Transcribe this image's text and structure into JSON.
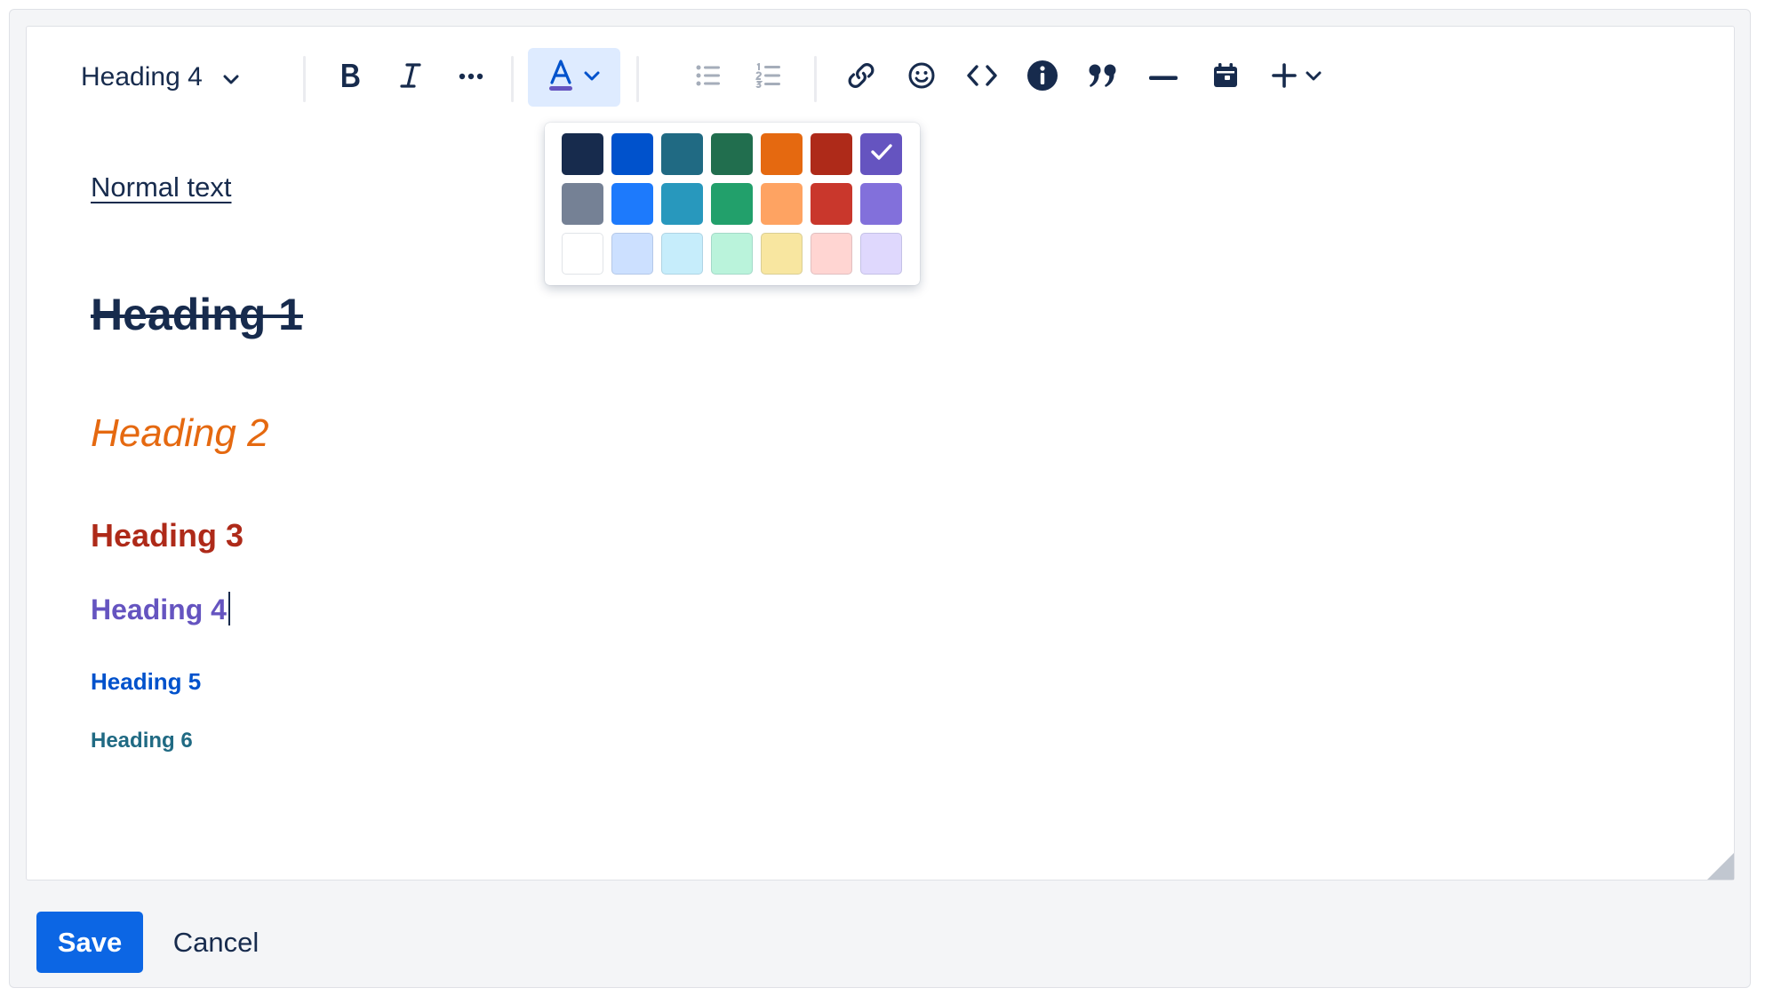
{
  "toolbar": {
    "heading_select": {
      "label": "Heading 4",
      "icon": "chevron-down-icon"
    },
    "buttons": [
      {
        "name": "bold",
        "icon": "bold-icon"
      },
      {
        "name": "italic",
        "icon": "italic-icon"
      },
      {
        "name": "more-formatting",
        "icon": "more-icon"
      },
      {
        "name": "text-color",
        "icon": "text-color-icon"
      },
      {
        "name": "bullet-list",
        "icon": "bullet-list-icon"
      },
      {
        "name": "numbered-list",
        "icon": "numbered-list-icon"
      },
      {
        "name": "link",
        "icon": "link-icon"
      },
      {
        "name": "emoji",
        "icon": "emoji-icon"
      },
      {
        "name": "code",
        "icon": "code-icon"
      },
      {
        "name": "info-panel",
        "icon": "info-icon"
      },
      {
        "name": "quote",
        "icon": "quote-icon"
      },
      {
        "name": "divider",
        "icon": "divider-icon"
      },
      {
        "name": "date",
        "icon": "calendar-icon"
      },
      {
        "name": "insert",
        "icon": "plus-icon"
      }
    ],
    "text_color_underline": "#6554C0"
  },
  "palette": {
    "rows": [
      [
        "#172B4D",
        "#0052CC",
        "#206A83",
        "#216E4E",
        "#E56910",
        "#AE2A19",
        "#6554C0"
      ],
      [
        "#758195",
        "#1D7AFC",
        "#2898BD",
        "#22A06B",
        "#FEA362",
        "#C9372C",
        "#8270DB"
      ],
      [
        "#FFFFFF",
        "#CCE0FF",
        "#C6EDFB",
        "#BAF3DB",
        "#F8E6A0",
        "#FFD5D2",
        "#DFD8FD"
      ]
    ],
    "selected": "#6554C0"
  },
  "content": {
    "normal": {
      "text": "Normal text ",
      "color": "#172B4D"
    },
    "h1": {
      "text": "Heading 1",
      "color": "#172B4D"
    },
    "h2": {
      "text": "Heading 2",
      "color": "#E56910"
    },
    "h3": {
      "text": "Heading 3",
      "color": "#AE2A19"
    },
    "h4": {
      "text": "Heading 4",
      "color": "#6554C0"
    },
    "h5": {
      "text": "Heading 5",
      "color": "#0052CC"
    },
    "h6": {
      "text": "Heading 6",
      "color": "#206A83"
    }
  },
  "footer": {
    "save_label": "Save",
    "cancel_label": "Cancel",
    "save_color": "#0C66E4"
  }
}
